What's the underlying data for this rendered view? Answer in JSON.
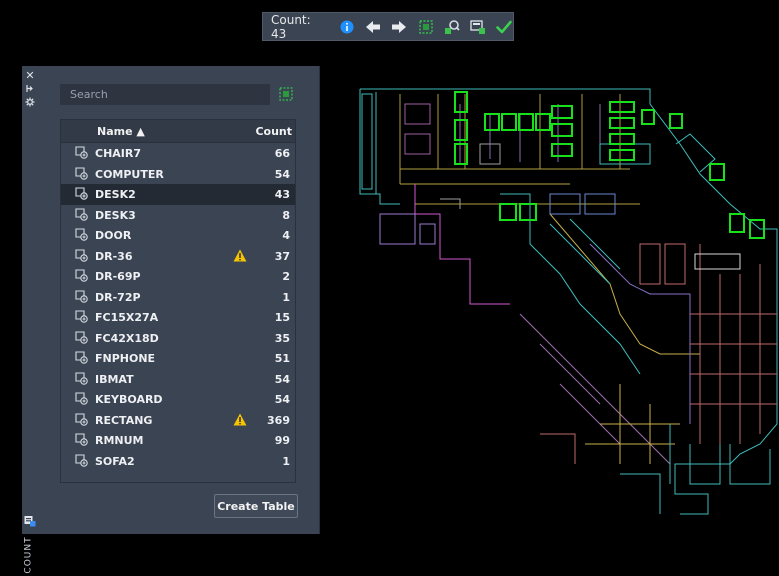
{
  "toolbar": {
    "count_label": "Count: 43",
    "icons": [
      "info-icon",
      "previous-arrow-icon",
      "next-arrow-icon",
      "select-objects-icon",
      "zoom-object-icon",
      "insert-field-icon",
      "finish-checkmark-icon"
    ]
  },
  "palette": {
    "title": "COUNT",
    "search_placeholder": "Search",
    "columns": {
      "name": "Name ▲",
      "count": "Count"
    },
    "rows": [
      {
        "name": "CHAIR7",
        "count": "66",
        "warning": false,
        "selected": false
      },
      {
        "name": "COMPUTER",
        "count": "54",
        "warning": false,
        "selected": false
      },
      {
        "name": "DESK2",
        "count": "43",
        "warning": false,
        "selected": true
      },
      {
        "name": "DESK3",
        "count": "8",
        "warning": false,
        "selected": false
      },
      {
        "name": "DOOR",
        "count": "4",
        "warning": false,
        "selected": false
      },
      {
        "name": "DR-36",
        "count": "37",
        "warning": true,
        "selected": false
      },
      {
        "name": "DR-69P",
        "count": "2",
        "warning": false,
        "selected": false
      },
      {
        "name": "DR-72P",
        "count": "1",
        "warning": false,
        "selected": false
      },
      {
        "name": "FC15X27A",
        "count": "15",
        "warning": false,
        "selected": false
      },
      {
        "name": "FC42X18D",
        "count": "35",
        "warning": false,
        "selected": false
      },
      {
        "name": "FNPHONE",
        "count": "51",
        "warning": false,
        "selected": false
      },
      {
        "name": "IBMAT",
        "count": "54",
        "warning": false,
        "selected": false
      },
      {
        "name": "KEYBOARD",
        "count": "54",
        "warning": false,
        "selected": false
      },
      {
        "name": "RECTANG",
        "count": "369",
        "warning": true,
        "selected": false
      },
      {
        "name": "RMNUM",
        "count": "99",
        "warning": false,
        "selected": false
      },
      {
        "name": "SOFA2",
        "count": "1",
        "warning": false,
        "selected": false
      }
    ],
    "create_table_label": "Create Table"
  },
  "colors": {
    "panel_bg": "#3b4453",
    "highlight_green": "#18e01a",
    "info_blue": "#1e90ff",
    "warning_yellow": "#f5c400"
  }
}
